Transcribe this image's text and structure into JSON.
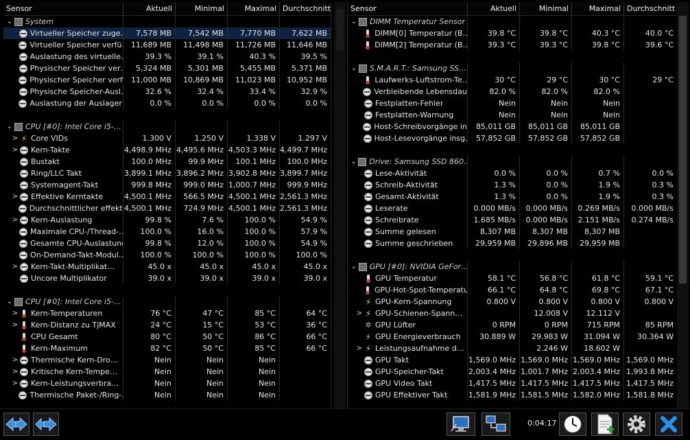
{
  "headers": {
    "sensor": "Sensor",
    "current": "Aktuell",
    "min": "Minimal",
    "max": "Maximal",
    "avg": "Durchschnitt"
  },
  "left_rows": [
    {
      "type": "group",
      "arrow": "⌄",
      "icon": "chip",
      "name": "System"
    },
    {
      "type": "row",
      "icon": "gauge",
      "name": "Virtueller Speicher zuge…",
      "v": [
        "7,578 MB",
        "7,542 MB",
        "7,770 MB",
        "7,622 MB"
      ],
      "sel": true
    },
    {
      "type": "row",
      "icon": "gauge",
      "name": "Virtueller Speicher verfü…",
      "v": [
        "11,689 MB",
        "11,498 MB",
        "11,726 MB",
        "11,646 MB"
      ]
    },
    {
      "type": "row",
      "icon": "gauge",
      "name": "Auslastung des virtuelle…",
      "v": [
        "39.3 %",
        "39.1 %",
        "40.3 %",
        "39.5 %"
      ]
    },
    {
      "type": "row",
      "icon": "gauge",
      "name": "Physischer Speicher ver…",
      "v": [
        "5,324 MB",
        "5,301 MB",
        "5,455 MB",
        "5,371 MB"
      ]
    },
    {
      "type": "row",
      "icon": "gauge",
      "name": "Physischer Speicher verf…",
      "v": [
        "11,000 MB",
        "10,869 MB",
        "11,023 MB",
        "10,952 MB"
      ]
    },
    {
      "type": "row",
      "icon": "gauge",
      "name": "Physische Speicher-Ausl…",
      "v": [
        "32.6 %",
        "32.4 %",
        "33.4 %",
        "32.9 %"
      ]
    },
    {
      "type": "row",
      "icon": "gauge",
      "name": "Auslastung der Auslager…",
      "v": [
        "0.0 %",
        "0.0 %",
        "0.0 %",
        "0.0 %"
      ]
    },
    {
      "type": "blank"
    },
    {
      "type": "group",
      "arrow": "⌄",
      "icon": "chip",
      "name": "CPU [#0]: Intel Core i5-…"
    },
    {
      "type": "row",
      "arrow": ">",
      "icon": "bolt",
      "name": "Core VIDs",
      "v": [
        "1.300 V",
        "1.250 V",
        "1.338 V",
        "1.297 V"
      ]
    },
    {
      "type": "row",
      "arrow": ">",
      "icon": "gauge",
      "name": "Kern-Takte",
      "v": [
        "4,498.9 MHz",
        "4,495.6 MHz",
        "4,503.3 MHz",
        "4,499.7 MHz"
      ]
    },
    {
      "type": "row",
      "icon": "gauge",
      "name": "Bustakt",
      "v": [
        "100.0 MHz",
        "99.9 MHz",
        "100.1 MHz",
        "100.0 MHz"
      ]
    },
    {
      "type": "row",
      "icon": "gauge",
      "name": "Ring/LLC Takt",
      "v": [
        "3,899.1 MHz",
        "3,896.2 MHz",
        "3,902.8 MHz",
        "3,899.7 MHz"
      ]
    },
    {
      "type": "row",
      "icon": "gauge",
      "name": "Systemagent-Takt",
      "v": [
        "999.8 MHz",
        "999.0 MHz",
        "1,000.7 MHz",
        "999.9 MHz"
      ]
    },
    {
      "type": "row",
      "arrow": ">",
      "icon": "gauge",
      "name": "Effektive Kerntakte",
      "v": [
        "4,500.1 MHz",
        "566.5 MHz",
        "4,500.1 MHz",
        "2,561.3 MHz"
      ]
    },
    {
      "type": "row",
      "icon": "gauge",
      "name": "Durchschnittlicher effekti…",
      "v": [
        "4,500.1 MHz",
        "724.9 MHz",
        "4,500.1 MHz",
        "2,561.3 MHz"
      ]
    },
    {
      "type": "row",
      "arrow": ">",
      "icon": "gauge",
      "name": "Kern-Auslastung",
      "v": [
        "99.8 %",
        "7.6 %",
        "100.0 %",
        "54.9 %"
      ]
    },
    {
      "type": "row",
      "icon": "gauge",
      "name": "Maximale CPU-/Thread-…",
      "v": [
        "100.0 %",
        "16.0 %",
        "100.0 %",
        "57.9 %"
      ]
    },
    {
      "type": "row",
      "icon": "gauge",
      "name": "Gesamte CPU-Auslastung",
      "v": [
        "99.8 %",
        "12.0 %",
        "100.0 %",
        "54.9 %"
      ]
    },
    {
      "type": "row",
      "icon": "gauge",
      "name": "On-Demand-Takt-Modul…",
      "v": [
        "100.0 %",
        "100.0 %",
        "100.0 %",
        "100.0 %"
      ]
    },
    {
      "type": "row",
      "arrow": ">",
      "icon": "gauge",
      "name": "Kern-Takt-Multiplikat…",
      "v": [
        "45.0 x",
        "45.0 x",
        "45.0 x",
        "45.0 x"
      ]
    },
    {
      "type": "row",
      "icon": "gauge",
      "name": "Uncore Multiplikator",
      "v": [
        "39.0 x",
        "39.0 x",
        "39.0 x",
        "39.0 x"
      ]
    },
    {
      "type": "blank"
    },
    {
      "type": "group",
      "arrow": "⌄",
      "icon": "chip",
      "name": "CPU [#0]: Intel Core i5-…"
    },
    {
      "type": "row",
      "arrow": ">",
      "icon": "therm",
      "name": "Kern-Temperaturen",
      "v": [
        "76 °C",
        "47 °C",
        "85 °C",
        "64 °C"
      ]
    },
    {
      "type": "row",
      "arrow": ">",
      "icon": "therm",
      "name": "Kern-Distanz zu TjMAX",
      "v": [
        "24 °C",
        "15 °C",
        "53 °C",
        "36 °C"
      ]
    },
    {
      "type": "row",
      "icon": "therm",
      "name": "CPU Gesamt",
      "v": [
        "80 °C",
        "50 °C",
        "86 °C",
        "66 °C"
      ]
    },
    {
      "type": "row",
      "icon": "therm",
      "name": "Kern-Maximum",
      "v": [
        "82 °C",
        "50 °C",
        "85 °C",
        "66 °C"
      ]
    },
    {
      "type": "row",
      "arrow": ">",
      "icon": "gauge",
      "name": "Thermische Kern-Dro…",
      "v": [
        "Nein",
        "Nein",
        "Nein",
        ""
      ]
    },
    {
      "type": "row",
      "arrow": ">",
      "icon": "gauge",
      "name": "Kritische Kern-Tempe…",
      "v": [
        "Nein",
        "Nein",
        "Nein",
        ""
      ]
    },
    {
      "type": "row",
      "arrow": ">",
      "icon": "gauge",
      "name": "Kern-Leistungsverbra…",
      "v": [
        "Nein",
        "Nein",
        "Nein",
        ""
      ]
    },
    {
      "type": "row",
      "icon": "gauge",
      "name": "Thermische Paket-/Ring-…",
      "v": [
        "Nein",
        "Nein",
        "Nein",
        ""
      ]
    }
  ],
  "right_rows": [
    {
      "type": "group",
      "arrow": "⌄",
      "icon": "chip",
      "name": "DIMM Temperatur Sensor"
    },
    {
      "type": "row",
      "icon": "therm",
      "name": "DIMM[0] Temperatur (B…",
      "v": [
        "39.8 °C",
        "39.8 °C",
        "40.3 °C",
        "40.0 °C"
      ]
    },
    {
      "type": "row",
      "icon": "therm",
      "name": "DIMM[2] Temperatur (B…",
      "v": [
        "39.3 °C",
        "39.3 °C",
        "39.8 °C",
        "39.6 °C"
      ]
    },
    {
      "type": "blank"
    },
    {
      "type": "group",
      "arrow": "⌄",
      "icon": "chip",
      "name": "S.M.A.R.T.: Samsung SS…"
    },
    {
      "type": "row",
      "icon": "therm",
      "name": "Laufwerks-Luftstrom-Te…",
      "v": [
        "30 °C",
        "29 °C",
        "30 °C",
        "29 °C"
      ]
    },
    {
      "type": "row",
      "icon": "gauge",
      "name": "Verbleibende Lebensdau…",
      "v": [
        "82.0 %",
        "82.0 %",
        "82.0 %",
        ""
      ]
    },
    {
      "type": "row",
      "icon": "gauge",
      "name": "Festplatten-Fehler",
      "v": [
        "Nein",
        "Nein",
        "Nein",
        ""
      ]
    },
    {
      "type": "row",
      "icon": "gauge",
      "name": "Festplatten-Warnung",
      "v": [
        "Nein",
        "Nein",
        "Nein",
        ""
      ]
    },
    {
      "type": "row",
      "icon": "gauge",
      "name": "Host-Schreibvorgänge in…",
      "v": [
        "85,011 GB",
        "85,011 GB",
        "85,011 GB",
        ""
      ]
    },
    {
      "type": "row",
      "icon": "gauge",
      "name": "Host-Lesevorgänge insg…",
      "v": [
        "57,852 GB",
        "57,852 GB",
        "57,852 GB",
        ""
      ]
    },
    {
      "type": "blank"
    },
    {
      "type": "group",
      "arrow": "⌄",
      "icon": "chip",
      "name": "Drive: Samsung SSD 860…"
    },
    {
      "type": "row",
      "icon": "gauge",
      "name": "Lese-Aktivität",
      "v": [
        "0.0 %",
        "0.0 %",
        "0.7 %",
        "0.0 %"
      ]
    },
    {
      "type": "row",
      "icon": "gauge",
      "name": "Schreib-Aktivität",
      "v": [
        "1.3 %",
        "0.0 %",
        "1.9 %",
        "0.3 %"
      ]
    },
    {
      "type": "row",
      "icon": "gauge",
      "name": "Gesamt-Aktivität",
      "v": [
        "1.3 %",
        "0.0 %",
        "1.9 %",
        "0.3 %"
      ]
    },
    {
      "type": "row",
      "icon": "gauge",
      "name": "Leserate",
      "v": [
        "0.000 MB/s",
        "0.000 MB/s",
        "0.269 MB/s",
        "0.000 MB/s"
      ]
    },
    {
      "type": "row",
      "icon": "gauge",
      "name": "Schreibrate",
      "v": [
        "1.685 MB/s",
        "0.000 MB/s",
        "2.151 MB/s",
        "0.274 MB/s"
      ]
    },
    {
      "type": "row",
      "icon": "gauge",
      "name": "Summe gelesen",
      "v": [
        "8,307 MB",
        "8,307 MB",
        "8,307 MB",
        ""
      ]
    },
    {
      "type": "row",
      "icon": "gauge",
      "name": "Summe geschrieben",
      "v": [
        "29,959 MB",
        "29,896 MB",
        "29,959 MB",
        ""
      ]
    },
    {
      "type": "blank"
    },
    {
      "type": "group",
      "arrow": "⌄",
      "icon": "chip",
      "name": "GPU [#0]: NVIDIA GeFor…"
    },
    {
      "type": "row",
      "icon": "therm",
      "name": "GPU Temperatur",
      "v": [
        "58.1 °C",
        "56.8 °C",
        "61.8 °C",
        "59.1 °C"
      ]
    },
    {
      "type": "row",
      "icon": "therm",
      "name": "GPU-Hot-Spot-Temperatur",
      "v": [
        "66.1 °C",
        "64.8 °C",
        "69.8 °C",
        "67.1 °C"
      ]
    },
    {
      "type": "row",
      "icon": "bolt",
      "name": "GPU-Kern-Spannung",
      "v": [
        "0.800 V",
        "0.800 V",
        "0.800 V",
        "0.800 V"
      ]
    },
    {
      "type": "row",
      "arrow": ">",
      "icon": "bolt",
      "name": "GPU-Schienen-Spann…",
      "v": [
        "",
        "12.008 V",
        "12.112 V",
        ""
      ]
    },
    {
      "type": "row",
      "icon": "fan",
      "name": "GPU Lüfter",
      "v": [
        "0 RPM",
        "0 RPM",
        "715 RPM",
        "85 RPM"
      ]
    },
    {
      "type": "row",
      "icon": "bolt",
      "name": "GPU Energieverbrauch",
      "v": [
        "30.889 W",
        "29.983 W",
        "31.094 W",
        "30.364 W"
      ]
    },
    {
      "type": "row",
      "arrow": ">",
      "icon": "bolt",
      "name": "Leistungsaufnahme d…",
      "v": [
        "",
        "2.246 W",
        "18.602 W",
        ""
      ]
    },
    {
      "type": "row",
      "icon": "gauge",
      "name": "GPU Takt",
      "v": [
        "1,569.0 MHz",
        "1,569.0 MHz",
        "1,569.0 MHz",
        "1,569.0 MHz"
      ]
    },
    {
      "type": "row",
      "icon": "gauge",
      "name": "GPU-Speicher-Takt",
      "v": [
        "2,003.4 MHz",
        "1,001.7 MHz",
        "2,003.4 MHz",
        "1,993.8 MHz"
      ]
    },
    {
      "type": "row",
      "icon": "gauge",
      "name": "GPU Video Takt",
      "v": [
        "1,417.5 MHz",
        "1,417.5 MHz",
        "1,417.5 MHz",
        "1,417.5 MHz"
      ]
    },
    {
      "type": "row",
      "icon": "gauge",
      "name": "GPU Effektiver Takt",
      "v": [
        "1,581.9 MHz",
        "1,581.5 MHz",
        "1,582.0 MHz",
        "1,581.8 MHz"
      ]
    }
  ],
  "toolbar": {
    "time": "0:04:17",
    "buttons": [
      "prev-nav",
      "next-nav",
      "network-screen",
      "network-share",
      "clock",
      "report-add",
      "settings",
      "close"
    ]
  },
  "colors": {
    "selected_row": "#0d2340",
    "bolt": "#ffcc00",
    "close_blue": "#1a7fd6"
  }
}
